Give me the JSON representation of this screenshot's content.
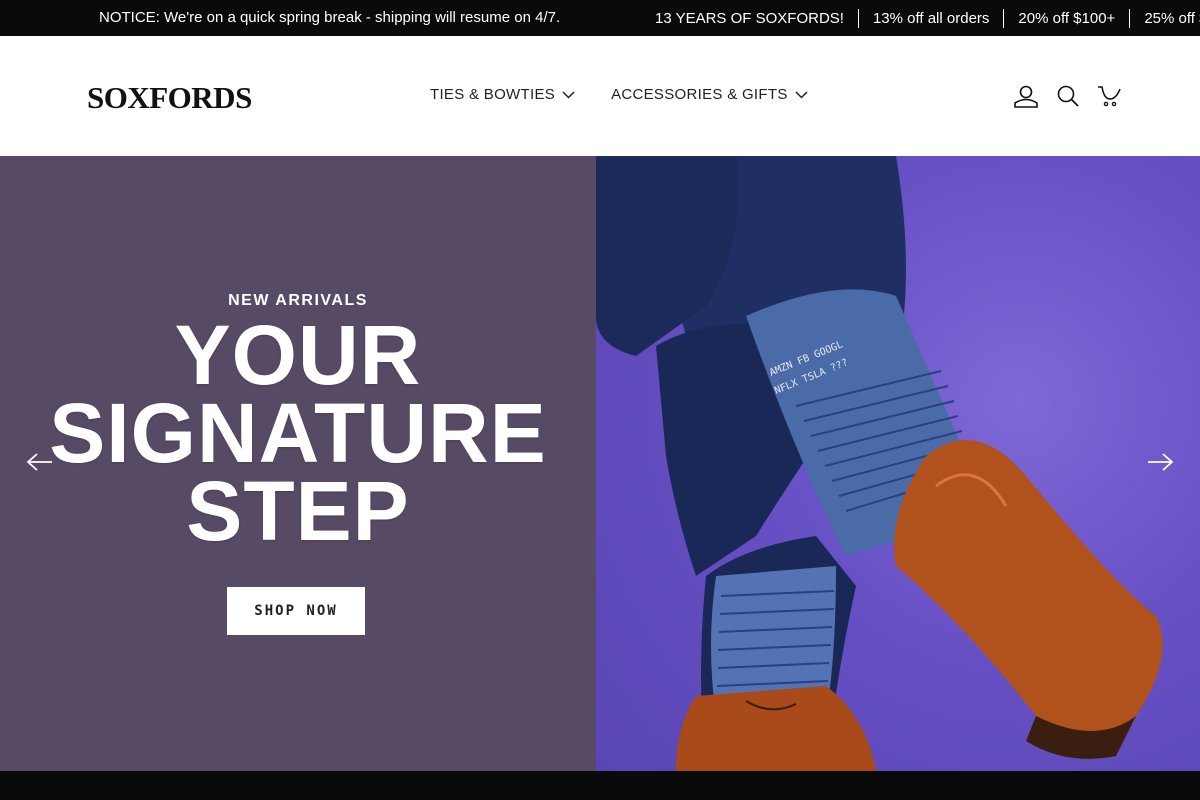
{
  "announcement": {
    "notice": "NOTICE: We're on a quick spring break - shipping will resume on 4/7.",
    "promos": [
      "13 YEARS OF SOXFORDS!",
      "13% off all orders",
      "20% off $100+",
      "25% off $150+"
    ]
  },
  "header": {
    "logo": "SOXFORDS",
    "nav": [
      {
        "label": "TIES & BOWTIES",
        "icon": "chevron-down-icon"
      },
      {
        "label": "ACCESSORIES & GIFTS",
        "icon": "chevron-down-icon"
      }
    ],
    "icons": [
      "account-icon",
      "search-icon",
      "cart-icon"
    ]
  },
  "hero": {
    "eyebrow": "NEW ARRIVALS",
    "headline": [
      "YOUR",
      "SIGNATURE",
      "STEP"
    ],
    "cta": "SHOP NOW",
    "prev_icon": "arrow-left-icon",
    "next_icon": "arrow-right-icon",
    "image_alt": "Legs in navy pants crossed, wearing blue striped stock-ticker socks and brown leather oxford shoes"
  },
  "colors": {
    "announcement_bg": "#0a0a0a",
    "hero_left_bg": "#574a64",
    "hero_right_bg": "#6650c4"
  }
}
